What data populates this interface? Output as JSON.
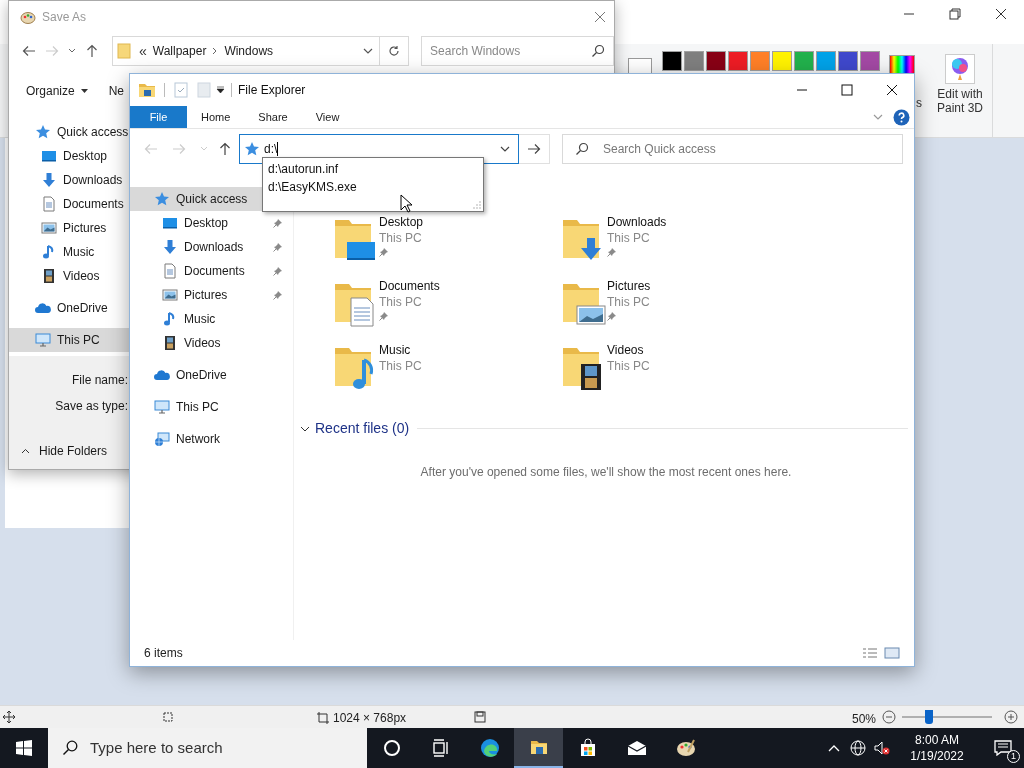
{
  "paint": {
    "palette": [
      {
        "color": "#000000"
      },
      {
        "color": "#7f7f7f"
      },
      {
        "color": "#880015"
      },
      {
        "color": "#ed1c24"
      },
      {
        "color": "#ff7f27"
      },
      {
        "color": "#fff200"
      },
      {
        "color": "#22b14c"
      },
      {
        "color": "#00a2e8"
      },
      {
        "color": "#3f48cc"
      },
      {
        "color": "#a349a4"
      }
    ],
    "edit_colors_label": "s",
    "paint3d_button": "Edit with Paint 3D",
    "status": {
      "dimensions": "1024 × 768px",
      "zoom": "50%",
      "zoom_slider": {
        "level": 0.3
      }
    }
  },
  "save_as": {
    "title": "Save As",
    "breadcrumb_overflow": "«",
    "path": [
      "Wallpaper",
      "Windows"
    ],
    "search_placeholder": "Search Windows",
    "toolbar": [
      "Organize",
      "Ne"
    ],
    "nav": [
      {
        "label": "Quick access",
        "kind": "star",
        "selected": false
      },
      {
        "label": "Desktop",
        "kind": "desktop",
        "selected": false
      },
      {
        "label": "Downloads",
        "kind": "downloads",
        "selected": false
      },
      {
        "label": "Documents",
        "kind": "documents",
        "selected": false
      },
      {
        "label": "Pictures",
        "kind": "pictures",
        "selected": false
      },
      {
        "label": "Music",
        "kind": "music",
        "selected": false
      },
      {
        "label": "Videos",
        "kind": "videos",
        "selected": false
      },
      {
        "label": "OneDrive",
        "kind": "onedrive",
        "selected": false
      },
      {
        "label": "This PC",
        "kind": "pc",
        "selected": true
      }
    ],
    "fields": [
      "File name:",
      "Save as type:"
    ],
    "hide_folders": "Hide Folders"
  },
  "explorer": {
    "title": "File Explorer",
    "tabs": [
      {
        "label": "File",
        "kind": "file"
      },
      {
        "label": "Home",
        "kind": "tab"
      },
      {
        "label": "Share",
        "kind": "tab"
      },
      {
        "label": "View",
        "kind": "tab"
      }
    ],
    "address": "d:\\",
    "suggestions": [
      "d:\\autorun.inf",
      "d:\\EasyKMS.exe"
    ],
    "search_placeholder": "Search Quick access",
    "nav": [
      {
        "label": "Quick access",
        "kind": "star",
        "selected": true,
        "children": [
          {
            "label": "Desktop",
            "kind": "desktop",
            "pinned": true,
            "selected": false
          },
          {
            "label": "Downloads",
            "kind": "downloads",
            "pinned": true,
            "selected": false
          },
          {
            "label": "Documents",
            "kind": "documents",
            "pinned": true,
            "selected": false
          },
          {
            "label": "Pictures",
            "kind": "pictures",
            "pinned": true,
            "selected": false
          },
          {
            "label": "Music",
            "kind": "music",
            "pinned": false,
            "selected": false
          },
          {
            "label": "Videos",
            "kind": "videos",
            "pinned": false,
            "selected": false
          }
        ]
      },
      {
        "label": "OneDrive",
        "kind": "onedrive",
        "selected": false
      },
      {
        "label": "This PC",
        "kind": "pc",
        "selected": false
      },
      {
        "label": "Network",
        "kind": "network",
        "selected": false
      }
    ],
    "folders": [
      {
        "name": "Desktop",
        "location": "This PC",
        "kind": "desktop",
        "pinned": true
      },
      {
        "name": "Downloads",
        "location": "This PC",
        "kind": "downloads",
        "pinned": true
      },
      {
        "name": "Documents",
        "location": "This PC",
        "kind": "documents",
        "pinned": true
      },
      {
        "name": "Pictures",
        "location": "This PC",
        "kind": "pictures",
        "pinned": true
      },
      {
        "name": "Music",
        "location": "This PC",
        "kind": "music",
        "pinned": false
      },
      {
        "name": "Videos",
        "location": "This PC",
        "kind": "videos",
        "pinned": false
      }
    ],
    "recent": {
      "title": "Recent files (0)",
      "expanded": true,
      "message": "After you've opened some files, we'll show the most recent ones here."
    },
    "status": "6 items"
  },
  "taskbar": {
    "search_placeholder": "Type here to search",
    "apps": [
      {
        "kind": "cortana",
        "selected": false
      },
      {
        "kind": "taskview",
        "selected": false
      },
      {
        "kind": "edge",
        "selected": false
      },
      {
        "kind": "explorer",
        "selected": true
      },
      {
        "kind": "store",
        "selected": false
      },
      {
        "kind": "mail",
        "selected": false
      },
      {
        "kind": "paint",
        "selected": false
      }
    ],
    "clock": {
      "time": "8:00 AM",
      "date": "1/19/2022"
    },
    "notifications": "1"
  }
}
